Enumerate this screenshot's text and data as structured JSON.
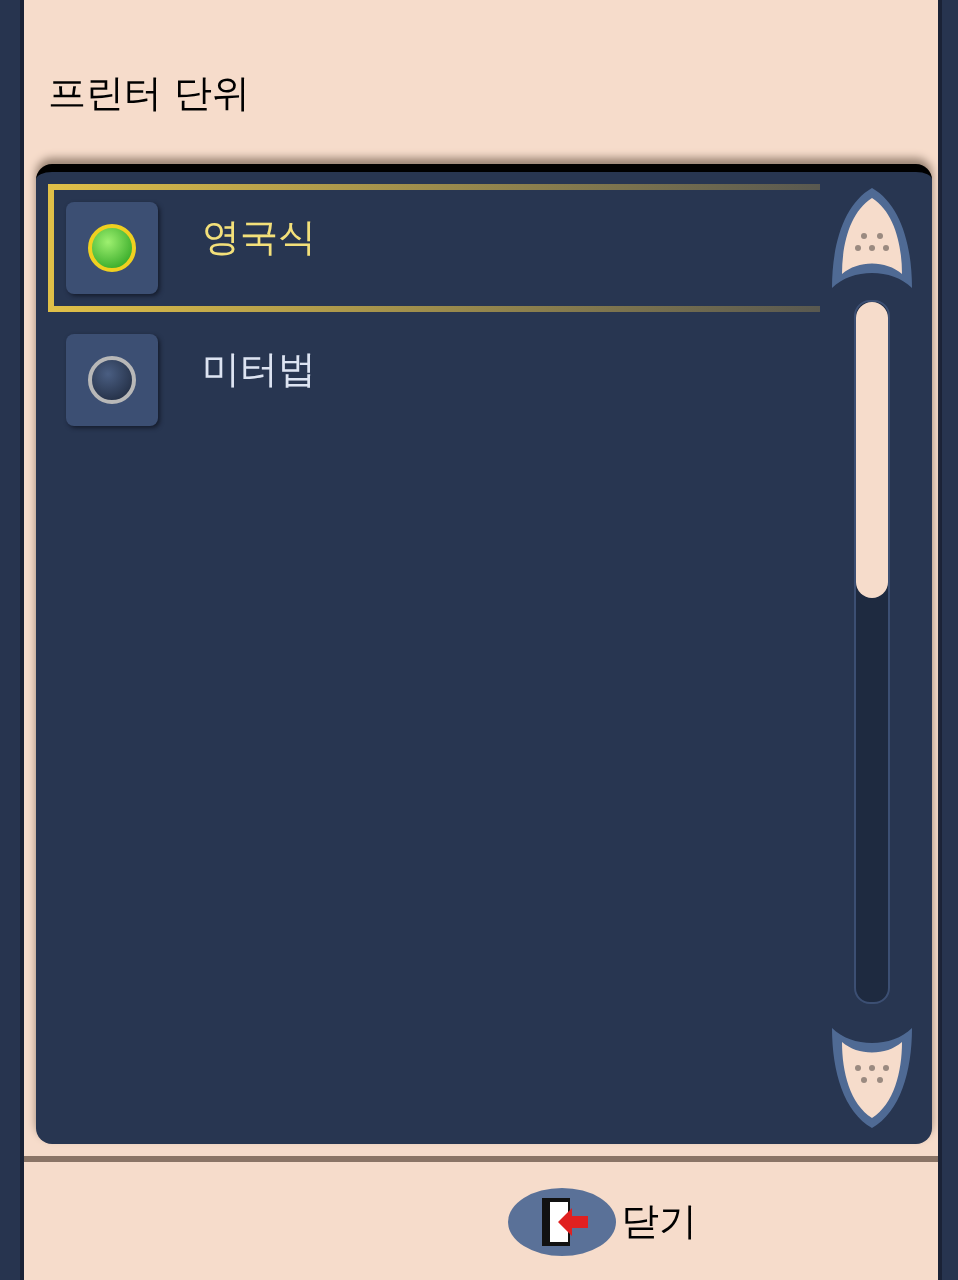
{
  "window": {
    "title": "프린터 단위"
  },
  "options": [
    {
      "label": "영국식",
      "selected": true
    },
    {
      "label": "미터법",
      "selected": false
    }
  ],
  "footer": {
    "close_button": "닫기"
  }
}
